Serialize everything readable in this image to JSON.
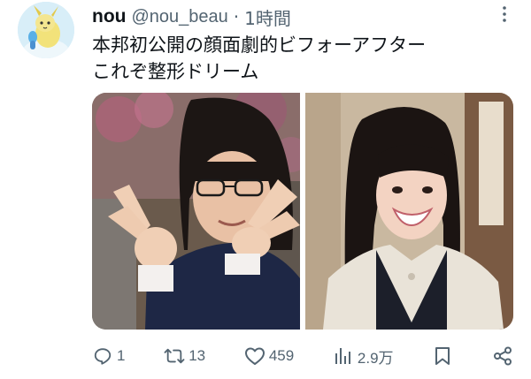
{
  "tweet": {
    "author": {
      "display_name": "nou",
      "handle": "@nou_beau",
      "separator": "·",
      "time": "1時間"
    },
    "text_lines": [
      "本邦初公開の顔面劇的ビフォーアフター",
      "これぞ整形ドリーム"
    ],
    "media": {
      "photos": [
        {
          "icon": "photo-before"
        },
        {
          "icon": "photo-after"
        }
      ]
    },
    "actions": {
      "reply": {
        "icon": "reply-icon",
        "count": "1"
      },
      "retweet": {
        "icon": "retweet-icon",
        "count": "13"
      },
      "like": {
        "icon": "like-icon",
        "count": "459"
      },
      "views": {
        "icon": "views-icon",
        "count": "2.9万"
      },
      "bookmark": {
        "icon": "bookmark-icon"
      },
      "share": {
        "icon": "share-icon"
      }
    },
    "colors": {
      "text": "#0f1419",
      "secondary": "#536471"
    }
  }
}
